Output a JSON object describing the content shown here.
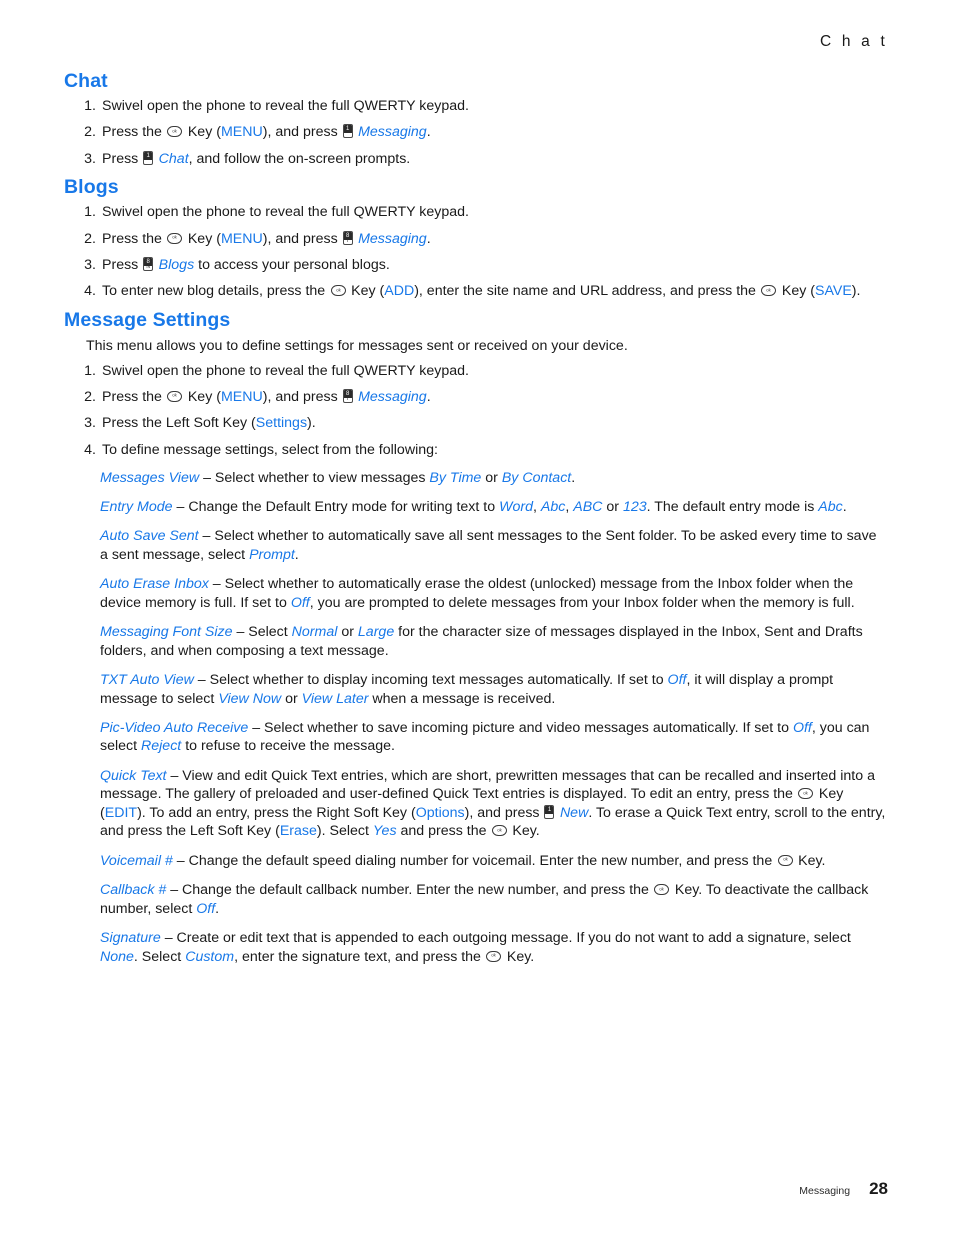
{
  "running_head": "C h a t",
  "colors": {
    "accent_blue": "#1878E8",
    "body_text": "#1a1a1a"
  },
  "icons": {
    "ok_key": "ok-key-icon",
    "key_1": {
      "top": "1",
      "bottom": ""
    },
    "key_8": {
      "top": "8",
      "bottom": "T"
    },
    "key_n": {
      "top": "8",
      "bottom": "N"
    },
    "key_new": {
      "top": "1",
      "bottom": ""
    }
  },
  "sections": {
    "chat": {
      "title": "Chat",
      "steps": {
        "s1": "Swivel open the phone to reveal the full QWERTY keypad.",
        "s2_a": "Press the",
        "s2_b": "Key (",
        "s2_menu": "MENU",
        "s2_c": "), and press",
        "s2_messaging": "Messaging",
        "s2_d": ".",
        "s3_a": "Press",
        "s3_chat": "Chat",
        "s3_b": ", and follow the on-screen prompts."
      }
    },
    "blogs": {
      "title": "Blogs",
      "steps": {
        "s1": "Swivel open the phone to reveal the full QWERTY keypad.",
        "s2_a": "Press the",
        "s2_b": "Key (",
        "s2_menu": "MENU",
        "s2_c": "), and press",
        "s2_messaging": "Messaging",
        "s2_d": ".",
        "s3_a": "Press",
        "s3_blogs": "Blogs",
        "s3_b": "to access your personal blogs.",
        "s4_a": "To enter new blog details, press the",
        "s4_b": "Key (",
        "s4_add": "ADD",
        "s4_c": "), enter the site name and URL address, and press the",
        "s4_d": "Key (",
        "s4_save": "SAVE",
        "s4_e": ")."
      }
    },
    "message_settings": {
      "title": "Message Settings",
      "intro": "This menu allows you to define settings for messages sent or received on your device.",
      "steps": {
        "s1": "Swivel open the phone to reveal the full QWERTY keypad.",
        "s2_a": "Press the",
        "s2_b": "Key (",
        "s2_menu": "MENU",
        "s2_c": "), and press",
        "s2_messaging": "Messaging",
        "s2_d": ".",
        "s3_a": "Press the Left Soft Key (",
        "s3_settings": "Settings",
        "s3_b": ").",
        "s4": "To define message settings, select from the following:"
      },
      "settings": {
        "messages_view": {
          "term": "Messages View",
          "t1": "– Select whether to view messages",
          "v1": "By Time",
          "t2": "or",
          "v2": "By Contact",
          "t3": "."
        },
        "entry_mode": {
          "term": "Entry Mode",
          "t1": "– Change the Default Entry mode for writing text to",
          "v1": "Word",
          "sep1": ",",
          "v2": "Abc",
          "sep2": ",",
          "v3": "ABC",
          "t2": "or",
          "v4": "123",
          "t3": ". The default entry mode is",
          "v5": "Abc",
          "t4": "."
        },
        "auto_save_sent": {
          "term": "Auto Save Sent",
          "t1": "– Select whether to automatically save all sent messages to the Sent folder. To be asked every time to save a sent message, select",
          "v1": "Prompt",
          "t2": "."
        },
        "auto_erase_inbox": {
          "term": "Auto Erase Inbox",
          "t1": "– Select whether to automatically erase the oldest (unlocked) message from the Inbox folder when the device memory is full. If set to",
          "v1": "Off",
          "t2": ", you are prompted to delete messages from your Inbox folder when the memory is full."
        },
        "messaging_font_size": {
          "term": "Messaging Font Size",
          "t1": "– Select",
          "v1": "Normal",
          "t2": "or",
          "v2": "Large",
          "t3": "for the character size of messages displayed in the Inbox, Sent and Drafts folders, and when composing a text message."
        },
        "txt_auto_view": {
          "term": "TXT Auto View",
          "t1": "– Select whether to display incoming text messages automatically. If set to",
          "v1": "Off",
          "t2": ", it will display a prompt message to select",
          "v2": "View Now",
          "t3": "or",
          "v3": "View Later",
          "t4": "when a message is received."
        },
        "pic_video_auto_receive": {
          "term": "Pic-Video Auto Receive",
          "t1": "– Select whether to save incoming picture and video messages automatically. If set to",
          "v1": "Off",
          "t2": ", you can select",
          "v2": "Reject",
          "t3": "to refuse to receive the message."
        },
        "quick_text": {
          "term": "Quick Text",
          "t1": "– View and edit Quick Text entries, which are short, prewritten messages that can be recalled and inserted into a message. The gallery of preloaded and user-defined Quick Text entries is displayed. To edit an entry, press the",
          "t2": "Key (",
          "v1": "EDIT",
          "t3": "). To add an entry, press the Right Soft Key (",
          "v2": "Options",
          "t4": "), and press",
          "v3": "New",
          "t5": ". To erase a Quick Text entry, scroll to the entry, and press the Left Soft Key (",
          "v4": "Erase",
          "t6": "). Select",
          "v5": "Yes",
          "t7": "and press the",
          "t8": "Key."
        },
        "voicemail_num": {
          "term": "Voicemail #",
          "t1": "– Change the default speed dialing number for voicemail. Enter the new number, and press the",
          "t2": "Key."
        },
        "callback_num": {
          "term": "Callback #",
          "t1": "– Change the default callback number. Enter the new number, and press the",
          "t2": "Key. To deactivate the callback number, select",
          "v1": "Off",
          "t3": "."
        },
        "signature": {
          "term": "Signature",
          "t1": "– Create or edit text that is appended to each outgoing message. If you do not want to add a signature, select",
          "v1": "None",
          "t2": ". Select",
          "v2": "Custom",
          "t3": ", enter the signature text, and press the",
          "t4": "Key."
        }
      }
    }
  },
  "footer": {
    "label": "Messaging",
    "page_number": "28"
  }
}
